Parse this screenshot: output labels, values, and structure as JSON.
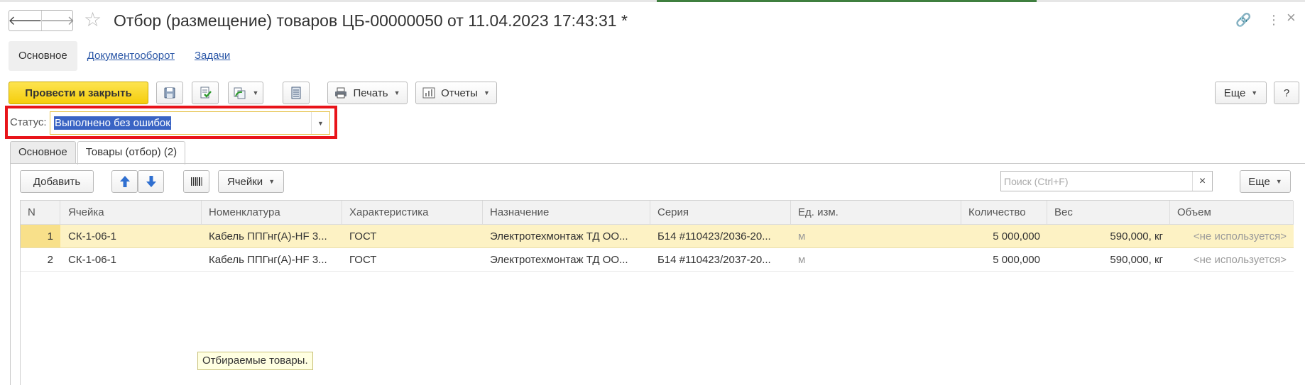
{
  "window": {
    "title": "Отбор (размещение) товаров ЦБ-00000050 от 11.04.2023 17:43:31 *",
    "icons": {
      "back": "arrow-left-icon",
      "forward": "arrow-right-icon",
      "favorite": "star-icon",
      "link": "link-icon",
      "menu": "kebab-menu-icon",
      "close": "close-icon"
    },
    "back_glyph": "🡐",
    "forward_glyph": "🡒",
    "star_glyph": "☆",
    "link_glyph": "🔗",
    "menu_glyph": "⋮",
    "close_glyph": "×"
  },
  "sections": [
    {
      "label": "Основное",
      "active": true
    },
    {
      "label": "Документооборот",
      "active": false
    },
    {
      "label": "Задачи",
      "active": false
    }
  ],
  "toolbar": {
    "post_close": "Провести и закрыть",
    "print": "Печать",
    "reports": "Отчеты",
    "more": "Еще",
    "help": "?",
    "icons": [
      "save-icon",
      "post-icon",
      "create-based-on-icon",
      "register-icon",
      "printer-icon",
      "reports-icon"
    ]
  },
  "status": {
    "label": "Статус:",
    "value": "Выполнено без ошибок"
  },
  "form_tabs": [
    {
      "label": "Основное",
      "active": false
    },
    {
      "label": "Товары (отбор) (2)",
      "active": true
    }
  ],
  "table_toolbar": {
    "add": "Добавить",
    "cells": "Ячейки",
    "search_placeholder": "Поиск (Ctrl+F)",
    "clear": "×",
    "more": "Еще",
    "icons": [
      "move-up-icon",
      "move-down-icon",
      "barcode-icon"
    ]
  },
  "table": {
    "columns": [
      "N",
      "Ячейка",
      "Номенклатура",
      "Характеристика",
      "Назначение",
      "Серия",
      "Ед. изм.",
      "Количество",
      "Вес",
      "Объем"
    ],
    "rows": [
      [
        "1",
        "СК-1-06-1",
        "Кабель ППГнг(А)-HF 3...",
        "ГОСТ",
        "Электротехмонтаж ТД ОО...",
        "Б14 #110423/2036-20...",
        "м",
        "5 000,000",
        "590,000, кг",
        "<не используется>"
      ],
      [
        "2",
        "СК-1-06-1",
        "Кабель ППГнг(А)-HF 3...",
        "ГОСТ",
        "Электротехмонтаж ТД ОО...",
        "Б14 #110423/2037-20...",
        "м",
        "5 000,000",
        "590,000, кг",
        "<не используется>"
      ]
    ]
  },
  "tooltip": "Отбираемые товары.",
  "colors": {
    "primary_button": "#f5cd0c",
    "highlight_frame": "#e8141a",
    "selected_row": "#fdf2c4",
    "selection": "#3a64c4",
    "link": "#2b57a7"
  }
}
